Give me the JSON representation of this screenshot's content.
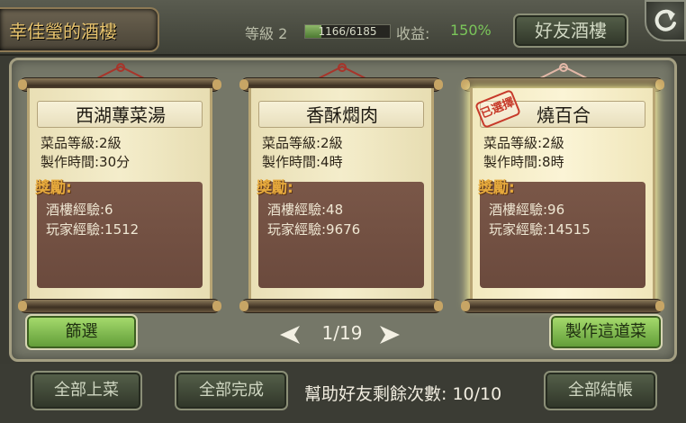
{
  "header": {
    "title": "幸佳瑩的酒樓",
    "level": "等級 2",
    "xp_text": "1166/6185",
    "xp_fraction": 0.19,
    "income_label": "收益:",
    "income_value": "150%",
    "friends_button": "好友酒樓"
  },
  "dishes": [
    {
      "name": "西湖蓴菜湯",
      "level": "菜品等級:2級",
      "time": "製作時間:30分",
      "reward_title": "獎勵:",
      "restaurant_xp": "酒樓經驗:6",
      "player_xp": "玩家經驗:1512",
      "selected": false
    },
    {
      "name": "香酥燜肉",
      "level": "菜品等級:2級",
      "time": "製作時間:4時",
      "reward_title": "獎勵:",
      "restaurant_xp": "酒樓經驗:48",
      "player_xp": "玩家經驗:9676",
      "selected": false
    },
    {
      "name": "燒百合",
      "level": "菜品等級:2級",
      "time": "製作時間:8時",
      "reward_title": "獎勵:",
      "restaurant_xp": "酒樓經驗:96",
      "player_xp": "玩家經驗:14515",
      "selected": true,
      "stamp": "已選擇"
    }
  ],
  "pager": {
    "page": "1/19"
  },
  "buttons": {
    "filter": "篩選",
    "make": "製作這道菜",
    "serve_all": "全部上菜",
    "finish_all": "全部完成",
    "checkout_all": "全部結帳"
  },
  "help": {
    "text": "幫助好友剩餘次數: 10/10"
  },
  "colors": {
    "accent_green": "#7bc65a",
    "title_gold": "#e8c46e",
    "reward_orange": "#e6a93c",
    "stamp_red": "#c73a2a"
  }
}
